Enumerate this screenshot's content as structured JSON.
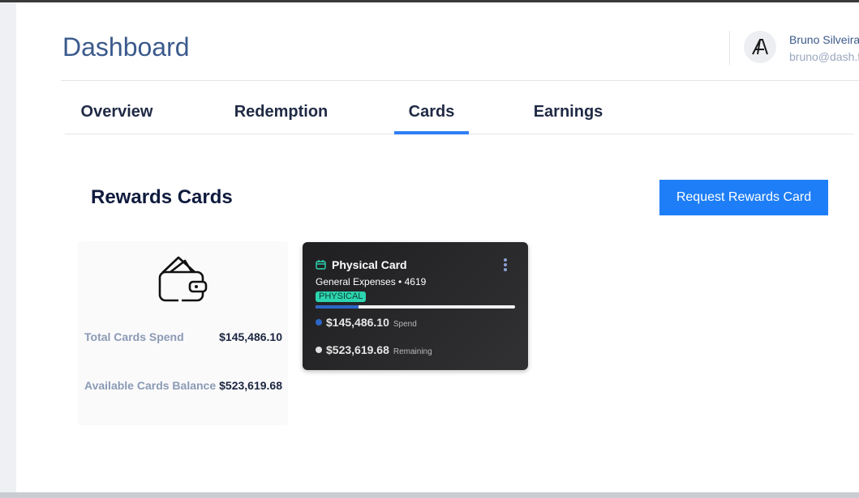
{
  "header": {
    "title": "Dashboard",
    "user": {
      "name": "Bruno Silveira",
      "email": "bruno@dash.fi"
    }
  },
  "tabs": [
    {
      "label": "Overview",
      "active": false
    },
    {
      "label": "Redemption",
      "active": false
    },
    {
      "label": "Cards",
      "active": true
    },
    {
      "label": "Earnings",
      "active": false
    }
  ],
  "section": {
    "title": "Rewards Cards",
    "request_button_label": "Request Rewards Card"
  },
  "summary": {
    "icon": "wallet-icon",
    "total_spend_label": "Total Cards Spend",
    "total_spend_value": "$145,486.10",
    "available_label": "Available Cards Balance",
    "available_value": "$523,619.68"
  },
  "card": {
    "icon": "calendar-icon",
    "title": "Physical Card",
    "subtitle": "General Expenses • 4619",
    "badge": "PHYSICAL",
    "spend_value": "$145,486.10",
    "spend_label": "Spend",
    "remaining_value": "$523,619.68",
    "remaining_label": "Remaining",
    "spend_fraction": 0.217
  },
  "colors": {
    "accent": "#1e7ef7",
    "title": "#3b5a8c",
    "badge": "#2cd5b0",
    "spend_dot": "#2c67c9",
    "remaining_dot": "#e0e0e0"
  }
}
